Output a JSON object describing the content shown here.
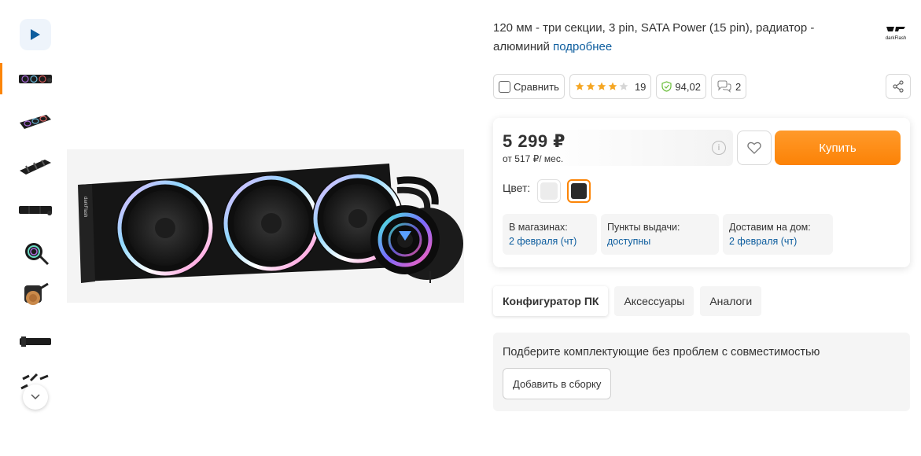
{
  "product": {
    "description": "120 мм - три секции, 3 pin, SATA Power (15 pin), радиатор - алюминий",
    "more_link": "подробнее",
    "brand_logo_text": "darkFlash"
  },
  "thumbnails": {
    "items": [
      {
        "name": "video"
      },
      {
        "name": "front-view"
      },
      {
        "name": "angle-view"
      },
      {
        "name": "side-view"
      },
      {
        "name": "top-view"
      },
      {
        "name": "pump-head"
      },
      {
        "name": "pump-copper-base"
      },
      {
        "name": "radiator-edge"
      },
      {
        "name": "accessories"
      }
    ]
  },
  "actions": {
    "compare_label": "Сравнить",
    "rating_stars": 4,
    "rating_max": 5,
    "reviews_count": "19",
    "reliability": "94,02",
    "questions_count": "2"
  },
  "buy": {
    "price": "5 299 ₽",
    "installment": "от 517 ₽/ мес.",
    "buy_label": "Купить",
    "color_label": "Цвет:",
    "colors": [
      {
        "value": "white",
        "hex": "#ececec",
        "selected": false
      },
      {
        "value": "black",
        "hex": "#2a2a2a",
        "selected": true
      }
    ],
    "availability": [
      {
        "title": "В магазинах:",
        "value": "2 февраля (чт)"
      },
      {
        "title": "Пункты выдачи:",
        "value": "доступны"
      },
      {
        "title": "Доставим на дом:",
        "value": "2 февраля (чт)"
      }
    ]
  },
  "tabs": [
    {
      "label": "Конфигуратор ПК",
      "active": true
    },
    {
      "label": "Аксессуары",
      "active": false
    },
    {
      "label": "Аналоги",
      "active": false
    }
  ],
  "configurator": {
    "text": "Подберите комплектующие без проблем с совместимостью",
    "button_label": "Добавить в сборку"
  },
  "colors": {
    "accent": "#fc8507",
    "link": "#0d5d9e",
    "star": "#f5a623",
    "reliability_icon": "#6cbf3c"
  }
}
